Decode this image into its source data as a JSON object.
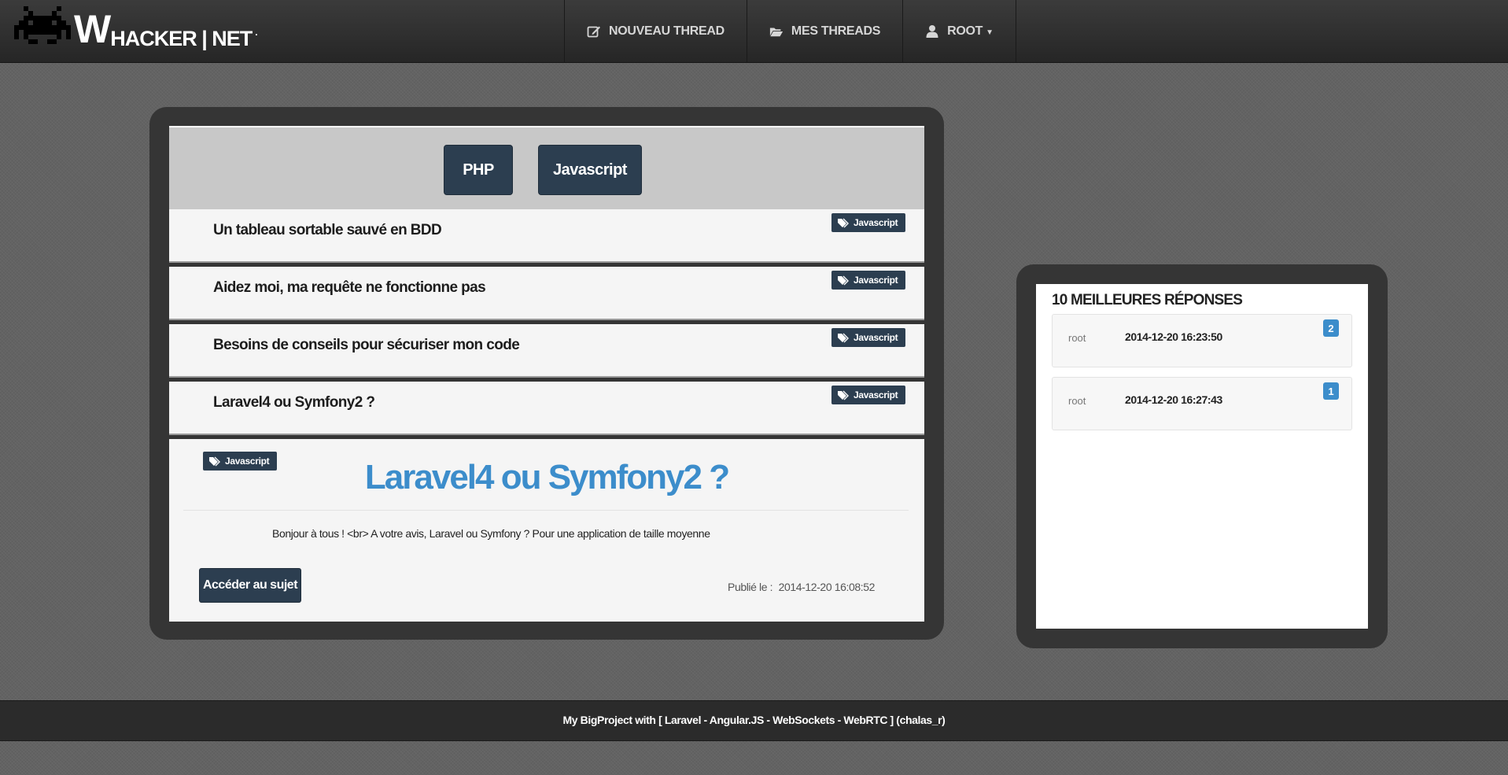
{
  "brand": {
    "w": "W",
    "name": "HACKER | NET",
    "dot": "."
  },
  "nav": [
    {
      "label": "NOUVEAU THREAD",
      "icon": "edit-icon"
    },
    {
      "label": "MES THREADS",
      "icon": "folder-open-icon"
    },
    {
      "label": "ROOT",
      "icon": "user-icon"
    }
  ],
  "tags": [
    "PHP",
    "Javascript"
  ],
  "threads": [
    {
      "title": "Un tableau sortable sauvé en BDD",
      "tag": "Javascript"
    },
    {
      "title": "Aidez moi, ma requête ne fonctionne pas",
      "tag": "Javascript"
    },
    {
      "title": "Besoins de conseils pour sécuriser mon code",
      "tag": "Javascript"
    },
    {
      "title": "Laravel4 ou Symfony2 ?",
      "tag": "Javascript"
    }
  ],
  "selected_thread": {
    "tag": "Javascript",
    "title": "Laravel4 ou Symfony2 ?",
    "body": "Bonjour à tous ! <br> A votre avis, Laravel ou Symfony ? Pour une application de taille moyenne",
    "access_button": "Accéder au sujet",
    "published_label": "Publié le :",
    "published_date": "2014-12-20 16:08:52"
  },
  "best_answers": {
    "title": "10 MEILLEURES RÉPONSES",
    "items": [
      {
        "user": "root",
        "date": "2014-12-20 16:23:50",
        "score": "2"
      },
      {
        "user": "root",
        "date": "2014-12-20 16:27:43",
        "score": "1"
      }
    ]
  },
  "footer": {
    "text": "My BigProject with  [ Laravel - Angular.JS - WebSockets - WebRTC ]   (chalas_r)"
  },
  "colors": {
    "accent": "#3c8dcb",
    "button": "#2c3e50",
    "panel": "#353535"
  }
}
